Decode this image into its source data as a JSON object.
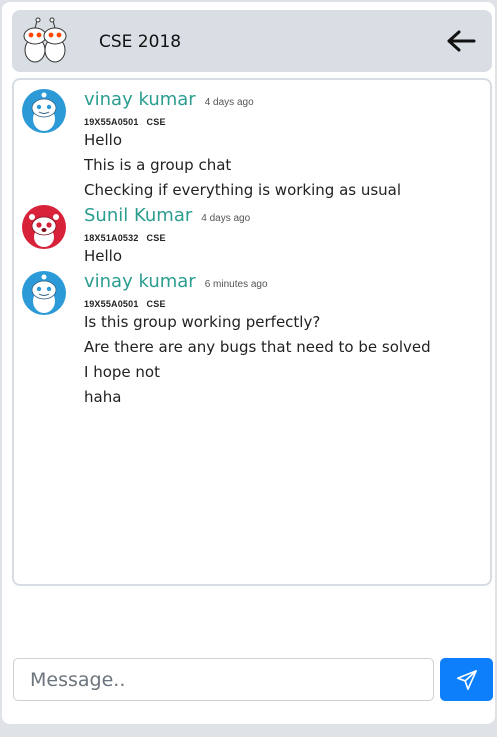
{
  "header": {
    "group_name": "CSE 2018",
    "back_icon": "arrow-left-icon",
    "avatar_icon": "group-snoo-avatar-icon"
  },
  "messages": [
    {
      "user": "vinay kumar",
      "time": "4 days ago",
      "roll": "19X55A0501",
      "dept": "CSE",
      "avatar_color": "#2d9ad8",
      "lines": [
        "Hello",
        "This is a group chat",
        "Checking if everything is working as usual"
      ]
    },
    {
      "user": "Sunil Kumar",
      "time": "4 days ago",
      "roll": "18X51A0532",
      "dept": "CSE",
      "avatar_color": "#d8223a",
      "lines": [
        "Hello"
      ]
    },
    {
      "user": "vinay kumar",
      "time": "6 minutes ago",
      "roll": "19X55A0501",
      "dept": "CSE",
      "avatar_color": "#2d9ad8",
      "lines": [
        "Is this group working perfectly?",
        "Are there are any bugs that need to be solved",
        "I hope not",
        "haha"
      ]
    }
  ],
  "composer": {
    "placeholder": "Message..",
    "send_icon": "paper-plane-icon"
  },
  "colors": {
    "username": "#2a9d8f",
    "send_button": "#0d7ffb",
    "header_bg": "#d9dee4"
  }
}
